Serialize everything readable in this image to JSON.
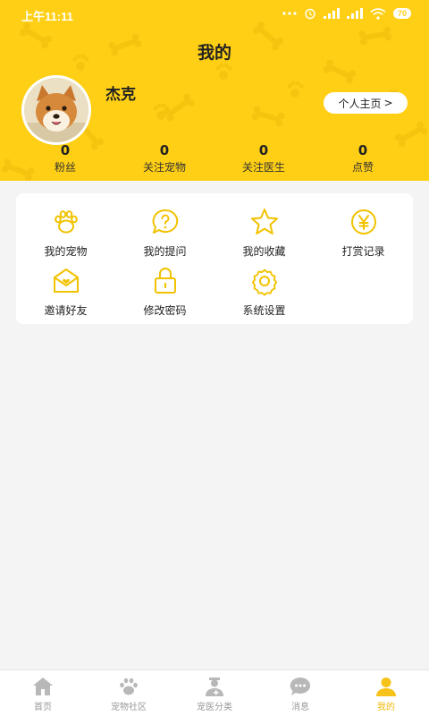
{
  "status_bar": {
    "time": "上午11:11",
    "battery": "70"
  },
  "header": {
    "title": "我的"
  },
  "profile": {
    "username": "杰克",
    "homepage_button": "个人主页",
    "homepage_chevron": ">"
  },
  "stats": [
    {
      "value": "0",
      "label": "粉丝"
    },
    {
      "value": "0",
      "label": "关注宠物"
    },
    {
      "value": "0",
      "label": "关注医生"
    },
    {
      "value": "0",
      "label": "点赞"
    }
  ],
  "menu": {
    "accent_color": "#f2c200",
    "items": [
      {
        "label": "我的宠物",
        "icon": "paw-icon"
      },
      {
        "label": "我的提问",
        "icon": "question-bubble-icon"
      },
      {
        "label": "我的收藏",
        "icon": "star-icon"
      },
      {
        "label": "打赏记录",
        "icon": "yen-coin-icon"
      },
      {
        "label": "邀请好友",
        "icon": "invite-envelope-icon"
      },
      {
        "label": "修改密码",
        "icon": "lock-icon"
      },
      {
        "label": "系统设置",
        "icon": "gear-icon"
      }
    ]
  },
  "bottom_nav": {
    "items": [
      {
        "label": "首页",
        "icon": "home-icon"
      },
      {
        "label": "宠物社区",
        "icon": "paw-icon"
      },
      {
        "label": "宠医分类",
        "icon": "doctor-icon"
      },
      {
        "label": "消息",
        "icon": "chat-icon"
      },
      {
        "label": "我的",
        "icon": "person-icon",
        "active": true
      }
    ]
  }
}
